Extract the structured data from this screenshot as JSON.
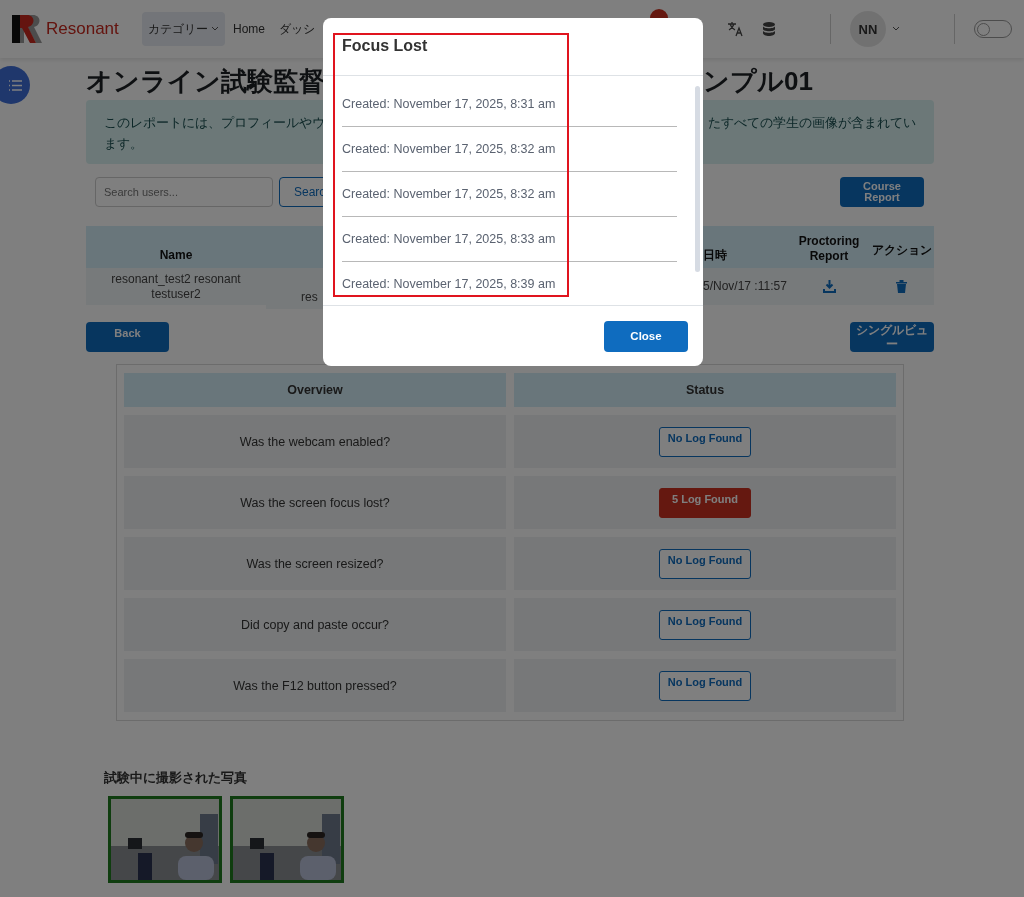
{
  "header": {
    "logo_text": "Resonant",
    "nav": [
      {
        "label": "カテゴリー",
        "kind": "dropdown",
        "selected": true
      },
      {
        "label": "Home",
        "kind": "link",
        "selected": false
      },
      {
        "label": "ダッシ",
        "kind": "link",
        "selected": false
      }
    ],
    "avatar": {
      "initials": "NN"
    },
    "theme_toggle": {
      "on": false
    }
  },
  "title_parts": [
    "オンライン試験監督",
    "ンプル01"
  ],
  "info_lines": [
    [
      "このレポートには、プロフィールやウ",
      "たすべての学生の画像が含まれてい"
    ],
    [
      "ます。"
    ]
  ],
  "search": {
    "placeholder": "Search users...",
    "button": "Searc"
  },
  "course_report_button": "Course Report",
  "users_table": {
    "columns": {
      "name": "Name",
      "date": "日時",
      "report": "Proctoring Report",
      "actions": "アクション"
    },
    "rows": [
      {
        "name": "resonant_test2 resonant testuser2",
        "column_2": "res",
        "date": "5/Nov/17 :11:57"
      }
    ]
  },
  "back_button": "Back",
  "single_view_button": "シングルビュー",
  "overview": {
    "columns": [
      "Overview",
      "Status"
    ],
    "rows": [
      {
        "question": "Was the webcam enabled?",
        "status": "No Log Found",
        "kind": "none"
      },
      {
        "question": "Was the screen focus lost?",
        "status": "5 Log Found",
        "kind": "found"
      },
      {
        "question": "Was the screen resized?",
        "status": "No Log Found",
        "kind": "none"
      },
      {
        "question": "Did copy and paste occur?",
        "status": "No Log Found",
        "kind": "none"
      },
      {
        "question": "Was the F12 button pressed?",
        "status": "No Log Found",
        "kind": "none"
      }
    ]
  },
  "photos": {
    "heading": "試験中に撮影された写真"
  },
  "modal": {
    "title": "Focus Lost",
    "entries": [
      "Created: November 17, 2025, 8:31 am",
      "Created: November 17, 2025, 8:32 am",
      "Created: November 17, 2025, 8:32 am",
      "Created: November 17, 2025, 8:33 am",
      "Created: November 17, 2025, 8:39 am"
    ],
    "close_button": "Close"
  }
}
